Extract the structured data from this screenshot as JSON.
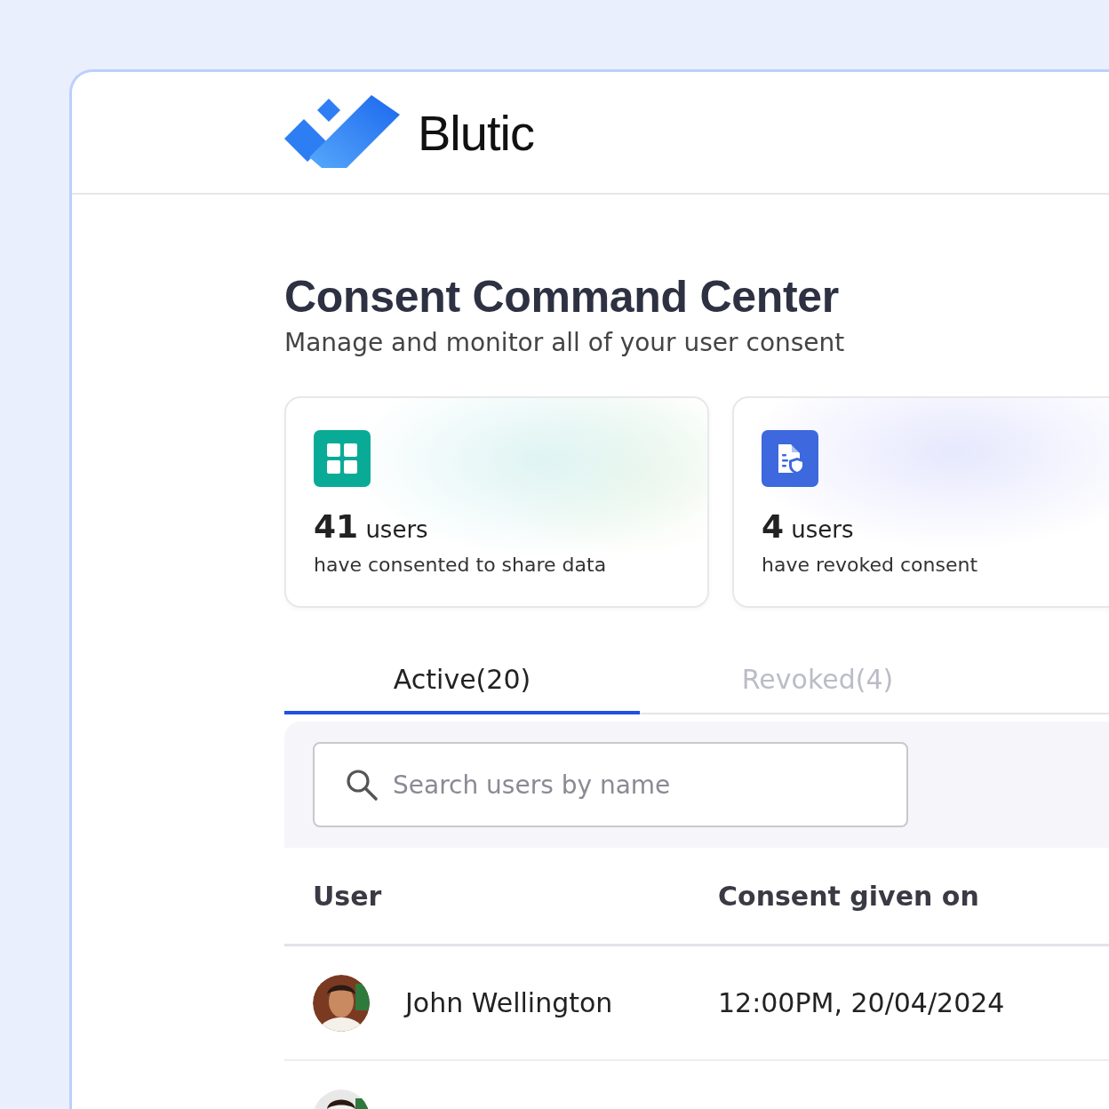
{
  "brand": {
    "name": "Blutic"
  },
  "page": {
    "title": "Consent Command Center",
    "subtitle": "Manage and monitor all of your user consent"
  },
  "stats": [
    {
      "kind": "consented",
      "count": "41",
      "unit": "users",
      "description": "have consented to share data"
    },
    {
      "kind": "revoked",
      "count": "4",
      "unit": "users",
      "description": "have revoked consent"
    }
  ],
  "tabs": [
    {
      "label": "Active(20)",
      "selected": true
    },
    {
      "label": "Revoked(4)",
      "selected": false
    }
  ],
  "search": {
    "placeholder": "Search users by name"
  },
  "table": {
    "columns": [
      "User",
      "Consent given on"
    ],
    "rows": [
      {
        "avatar": {
          "kind": "picture"
        },
        "user": "John Wellington",
        "consent_given_on": "12:00PM, 20/04/2024"
      },
      {
        "avatar": {
          "kind": "picture"
        }
      }
    ]
  }
}
